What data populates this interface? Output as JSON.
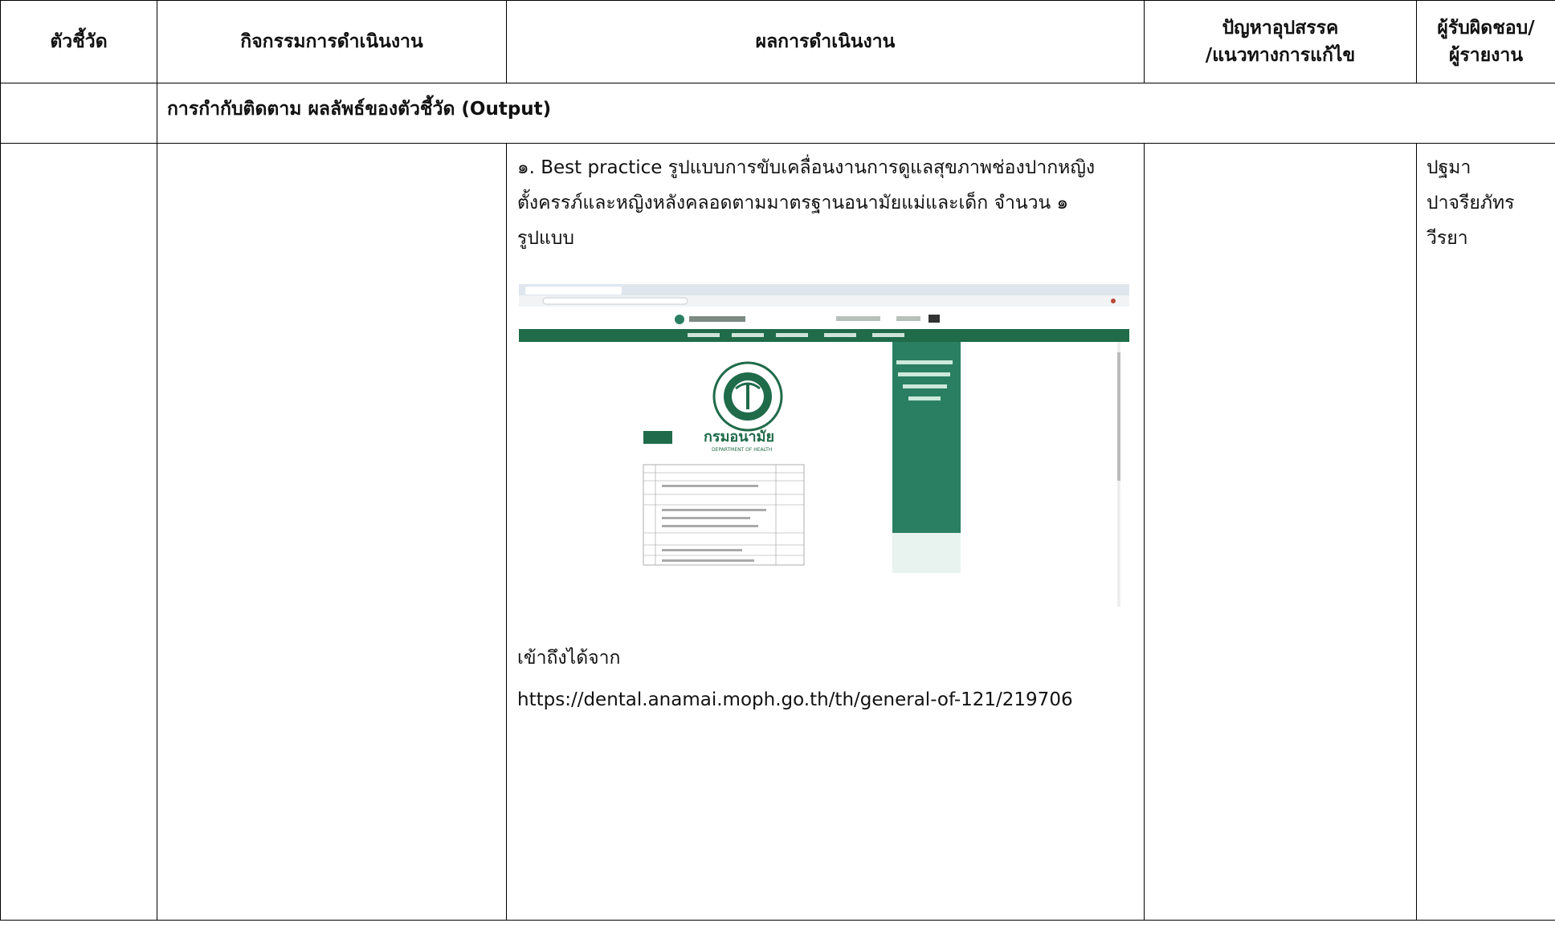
{
  "headers": {
    "indicator": "ตัวชี้วัด",
    "activity": "กิจกรรมการดำเนินงาน",
    "result": "ผลการดำเนินงาน",
    "problem_line1": "ปัญหาอุปสรรค",
    "problem_line2": "/แนวทางการแก้ไข",
    "responsible_line1": "ผู้รับผิดชอบ/",
    "responsible_line2": "ผู้รายงาน"
  },
  "section_title": "การกำกับติดตาม ผลลัพธ์ของตัวชี้วัด (Output)",
  "result": {
    "line1": "๑. Best practice รูปแบบการขับเคลื่อนงานการดูแลสุขภาพช่องปากหญิง",
    "line2": "ตั้งครรภ์และหญิงหลังคลอดตามมาตรฐานอนามัยแม่และเด็ก จำนวน ๑",
    "line3": "รูปแบบ",
    "access_label": "เข้าถึงได้จาก",
    "url": "https://dental.anamai.moph.go.th/th/general-of-121/219706"
  },
  "responsible": {
    "line1": "ปฐมา",
    "line2": "ปาจรียภัทร",
    "line3": "วีรยา"
  },
  "screenshot": {
    "logo_text": "กรมอนามัย",
    "logo_subtext": "DEPARTMENT OF HEALTH",
    "nav_color": "#1f6b4a",
    "panel_color": "#2a7f63"
  }
}
